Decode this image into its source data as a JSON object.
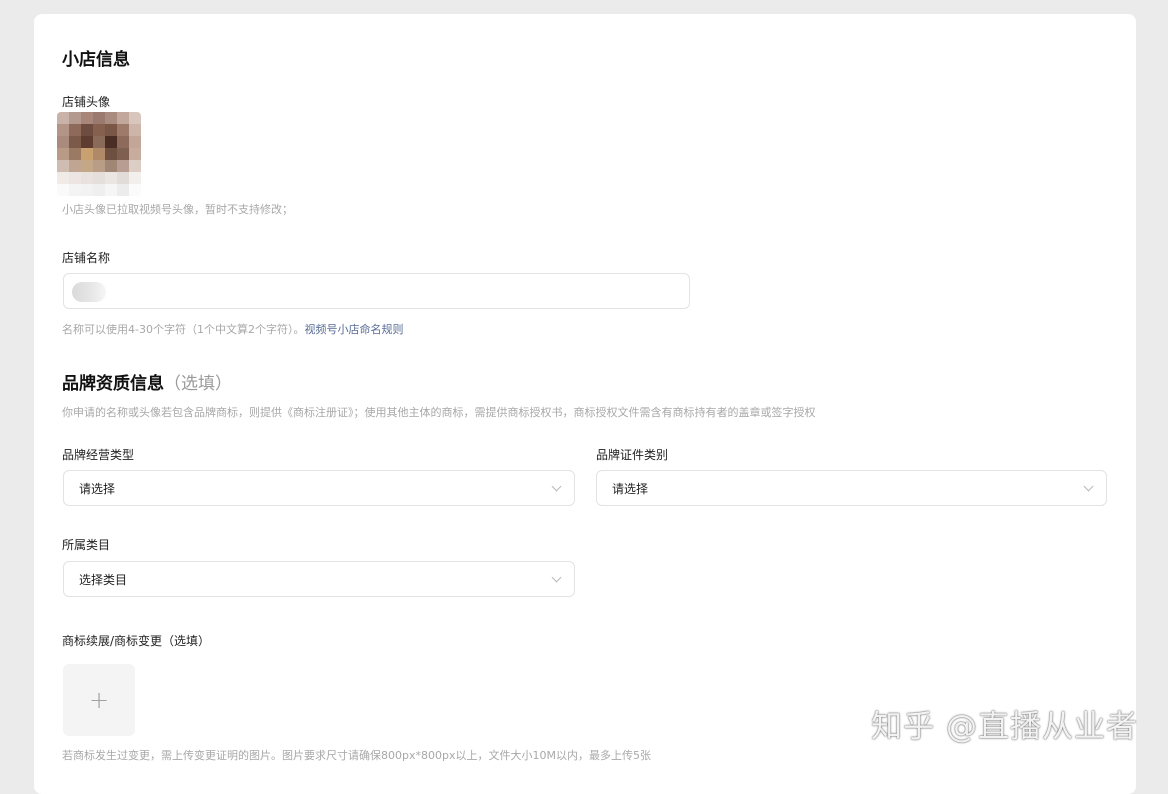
{
  "shop_info": {
    "title": "小店信息",
    "avatar_label": "店铺头像",
    "avatar_hint": "小店头像已拉取视频号头像，暂时不支持修改；",
    "name_label": "店铺名称",
    "name_hint": "名称可以使用4-30个字符（1个中文算2个字符）。",
    "name_rule_link": "视频号小店命名规则"
  },
  "avatar_colors": [
    [
      "#c9b3a8",
      "#b49a8e",
      "#a8877a",
      "#9a7a6e",
      "#a98b80",
      "#c2a79c",
      "#d8c6bd"
    ],
    [
      "#b39588",
      "#8e6a5a",
      "#6e4c3f",
      "#86604f",
      "#7a5646",
      "#9e7a6a",
      "#cdb5aa"
    ],
    [
      "#a98a7c",
      "#7c5a4a",
      "#5e3c30",
      "#8a6a58",
      "#4a2e24",
      "#8d6a5c",
      "#c2a698"
    ],
    [
      "#b99a86",
      "#9a7a62",
      "#c9a070",
      "#b08a68",
      "#6e5040",
      "#7e5f50",
      "#c8ad9e"
    ],
    [
      "#d0bdb2",
      "#bfa592",
      "#c4a784",
      "#b99d86",
      "#a08674",
      "#b89e92",
      "#dccdc5"
    ],
    [
      "#f1ebe8",
      "#ece5e2",
      "#e8e1de",
      "#e5dfdc",
      "#ece6e3",
      "#e2dcd9",
      "#f3efed"
    ],
    [
      "#fafafa",
      "#f4f4f4",
      "#f2f2f2",
      "#efefef",
      "#f6f6f6",
      "#ececec",
      "#fbfbfb"
    ]
  ],
  "brand_info": {
    "title": "品牌资质信息",
    "optional": "（选填）",
    "description": "你申请的名称或头像若包含品牌商标，则提供《商标注册证》；使用其他主体的商标，需提供商标授权书，商标授权文件需含有商标持有者的盖章或签字授权",
    "brand_type_label": "品牌经营类型",
    "brand_type_value": "请选择",
    "cert_type_label": "品牌证件类别",
    "cert_type_value": "请选择",
    "category_label": "所属类目",
    "category_value": "选择类目",
    "trademark_change_label": "商标续展/商标变更（选填）",
    "upload_plus": "+",
    "upload_hint": "若商标发生过变更，需上传变更证明的图片。图片要求尺寸请确保800px*800px以上，文件大小10M以内，最多上传5张"
  },
  "watermark": "知乎 @直播从业者"
}
